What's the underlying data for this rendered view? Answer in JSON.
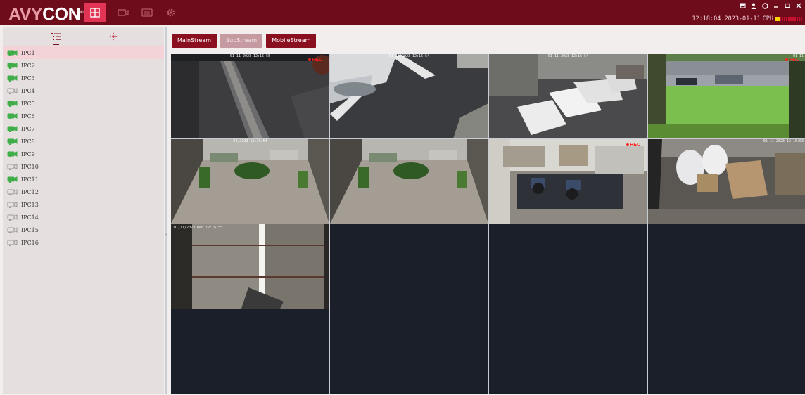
{
  "topbar": {
    "logo_part1": "AVY",
    "logo_part2": "CON",
    "time": "12:18:04 2023-01-11",
    "cpu_label": "CPU",
    "cpu_load_fraction": 0.18,
    "nav_icons": [
      "live-view-grid-icon",
      "playback-camera-icon",
      "device-manager-icon",
      "settings-gear-icon"
    ],
    "window_icons": [
      "screenshot-icon",
      "user-icon",
      "help-icon",
      "minimize-icon",
      "maximize-icon",
      "close-icon"
    ]
  },
  "sidebar": {
    "tabs": [
      "camera-list-icon",
      "ptz-control-icon"
    ],
    "cameras": [
      {
        "label": "IPC1",
        "online": true,
        "selected": true
      },
      {
        "label": "IPC2",
        "online": true
      },
      {
        "label": "IPC3",
        "online": true
      },
      {
        "label": "IPC4",
        "online": false
      },
      {
        "label": "IPC5",
        "online": true
      },
      {
        "label": "IPC6",
        "online": true
      },
      {
        "label": "IPC7",
        "online": true
      },
      {
        "label": "IPC8",
        "online": true
      },
      {
        "label": "IPC9",
        "online": true
      },
      {
        "label": "IPC10",
        "online": false
      },
      {
        "label": "IPC11",
        "online": true
      },
      {
        "label": "IPC12",
        "online": false
      },
      {
        "label": "IPC13",
        "online": false
      },
      {
        "label": "IPC14",
        "online": false
      },
      {
        "label": "IPC15",
        "online": false
      },
      {
        "label": "IPC16",
        "online": false
      }
    ],
    "colors": {
      "online": "#3fae49",
      "offline": "#9a9a9a"
    }
  },
  "streams": {
    "main": "MainStream",
    "sub": "SubStream",
    "mobile": "MobileStream"
  },
  "tiles": [
    {
      "osd": "01-11-2023 12:16:55",
      "rec": "REC",
      "scene": "parking-drain"
    },
    {
      "osd": "01-11-2023 12:16:54",
      "scene": "parking-cars"
    },
    {
      "osd": "01-11-2023 12:16:54",
      "scene": "parking-vans"
    },
    {
      "osd": "01-11",
      "rec": "REC",
      "scene": "lawn-street"
    },
    {
      "osd": "04/2023 12:16:54",
      "scene": "courtyard"
    },
    {
      "osd": "",
      "scene": "courtyard"
    },
    {
      "osd": "",
      "rec": "REC",
      "scene": "office"
    },
    {
      "osd": "01-11-2023 12:16:53",
      "scene": "warehouse"
    },
    {
      "osd": "01/11/2023 Wed 12:16:55",
      "scene": "interior-wall"
    },
    {
      "scene": "empty"
    },
    {
      "scene": "empty"
    },
    {
      "scene": "empty"
    },
    {
      "scene": "empty"
    },
    {
      "scene": "empty"
    },
    {
      "scene": "empty"
    },
    {
      "scene": "empty"
    }
  ]
}
